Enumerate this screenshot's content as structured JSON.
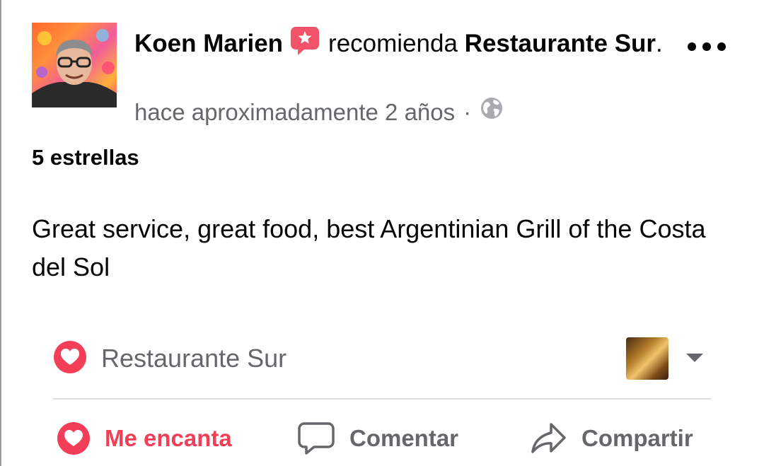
{
  "post": {
    "author": "Koen Marien",
    "verb": "recomienda",
    "page": "Restaurante Sur",
    "page_suffix": ".",
    "time": "hace aproximadamente 2 años",
    "separator": "·",
    "privacy_icon": "globe-icon",
    "more_icon": "more-options-icon"
  },
  "rating": "5 estrellas",
  "review_text": "Great service, great food, best Argentinian Grill of the Costa del Sol",
  "page_tag": {
    "name": "Restaurante Sur",
    "icon": "heart-icon",
    "caret_icon": "caret-down-icon"
  },
  "actions": {
    "love_label": "Me encanta",
    "comment_label": "Comentar",
    "share_label": "Compartir"
  },
  "colors": {
    "love": "#f33e58",
    "badge": "#f35369",
    "secondary_text": "#65676b"
  }
}
